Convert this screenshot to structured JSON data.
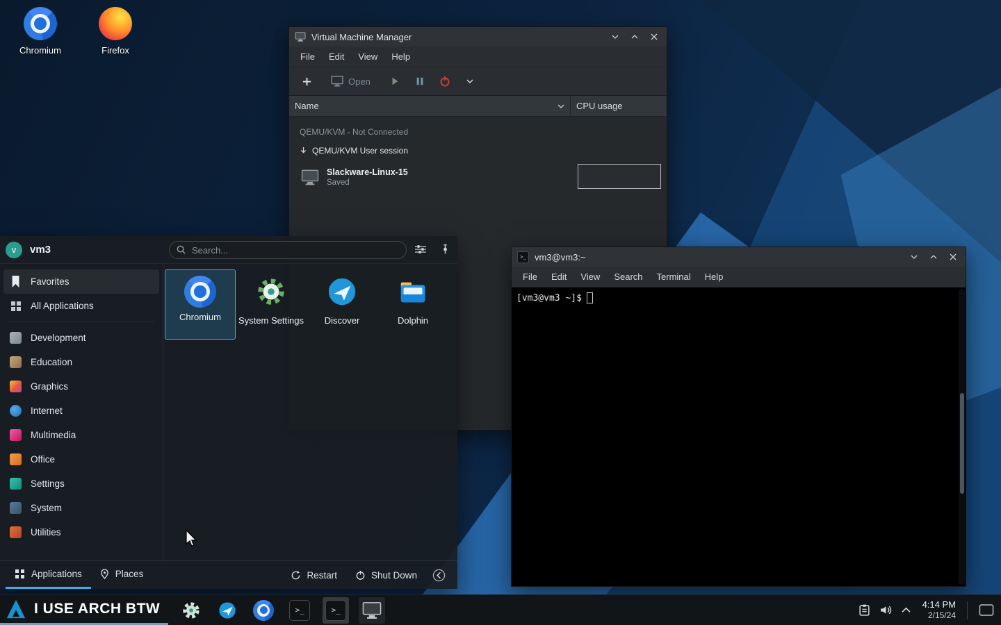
{
  "desktop": {
    "icons": [
      {
        "label": "Chromium"
      },
      {
        "label": "Firefox"
      }
    ]
  },
  "vmm": {
    "title": "Virtual Machine Manager",
    "menus": [
      {
        "label": "File"
      },
      {
        "label": "Edit"
      },
      {
        "label": "View"
      },
      {
        "label": "Help"
      }
    ],
    "toolbar": {
      "open": "Open"
    },
    "columns": {
      "name": "Name",
      "cpu": "CPU usage"
    },
    "list": {
      "disconnected": "QEMU/KVM - Not Connected",
      "session": "QEMU/KVM User session",
      "vm": {
        "name": "Slackware-Linux-15",
        "state": "Saved"
      }
    }
  },
  "launcher": {
    "user": {
      "name": "vm3",
      "initial": "v"
    },
    "search": {
      "placeholder": "Search..."
    },
    "sidebar": [
      {
        "label": "Favorites"
      },
      {
        "label": "All Applications"
      },
      {
        "label": "Development"
      },
      {
        "label": "Education"
      },
      {
        "label": "Graphics"
      },
      {
        "label": "Internet"
      },
      {
        "label": "Multimedia"
      },
      {
        "label": "Office"
      },
      {
        "label": "Settings"
      },
      {
        "label": "System"
      },
      {
        "label": "Utilities"
      }
    ],
    "favorites": [
      {
        "label": "Chromium"
      },
      {
        "label": "System Settings"
      },
      {
        "label": "Discover"
      },
      {
        "label": "Dolphin"
      }
    ],
    "footer": {
      "tabs": [
        {
          "label": "Applications"
        },
        {
          "label": "Places"
        }
      ],
      "actions": [
        {
          "label": "Restart"
        },
        {
          "label": "Shut Down"
        }
      ]
    }
  },
  "terminal": {
    "title": "vm3@vm3:~",
    "menus": [
      {
        "label": "File"
      },
      {
        "label": "Edit"
      },
      {
        "label": "View"
      },
      {
        "label": "Search"
      },
      {
        "label": "Terminal"
      },
      {
        "label": "Help"
      }
    ],
    "prompt": "[vm3@vm3 ~]$"
  },
  "taskbar": {
    "launcher_label": "I USE ARCH BTW",
    "clock": {
      "time": "4:14 PM",
      "date": "2/15/24"
    }
  },
  "colors": {
    "accent": "#3daee9",
    "arch_blue": "#1793d1"
  }
}
